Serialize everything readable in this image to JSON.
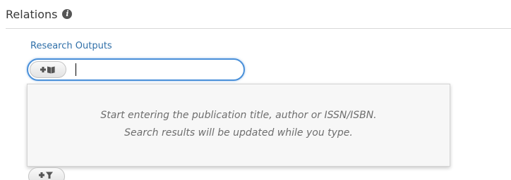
{
  "section": {
    "title": "Relations",
    "info_icon": "info-icon"
  },
  "research_outputs": {
    "label": "Research Outputs",
    "add_icon": "add-book-icon",
    "input_value": "",
    "hint_line_1": "Start entering the publication title, author or ISSN/ISBN.",
    "hint_line_2": "Search results will be updated while you type."
  },
  "next_field": {
    "add_icon": "add-filter-icon"
  },
  "colors": {
    "label": "#2f6fa8",
    "focus_border": "#4a90d9",
    "hint_text": "#6e6e6e",
    "icon": "#555555"
  }
}
